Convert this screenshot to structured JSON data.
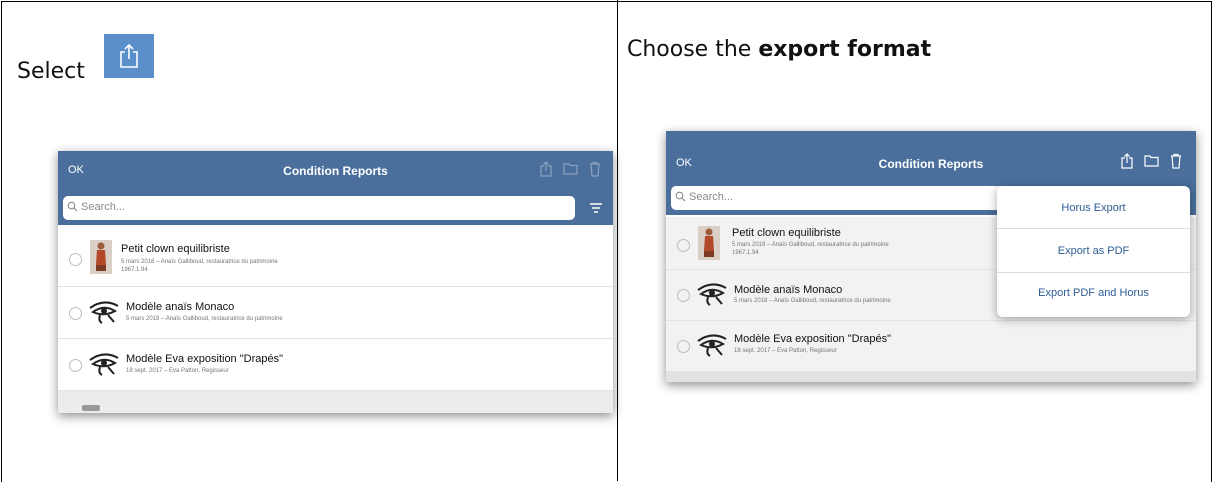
{
  "left_cell": {
    "instruction": "Select",
    "icon": "share-icon"
  },
  "right_cell": {
    "instruction_prefix": "Choose the ",
    "instruction_bold": "export format"
  },
  "app": {
    "ok_label": "OK",
    "title": "Condition Reports",
    "search_placeholder": "Search...",
    "search_placeholder_right": "Search...",
    "nav_color": "#4a6f9c",
    "accent": "#5b8fc9",
    "items": [
      {
        "title": "Petit clown equilibriste",
        "subtitle": "5 mars 2018 – Anaïs Galliboud, restauratrice du patrimoine",
        "subtitle2": "1967.1.94",
        "thumb": "statue-thumbnail"
      },
      {
        "title": "Modèle anaïs Monaco",
        "subtitle": "5 mars 2018 – Anaïs Galliboud, restauratrice du patrimoine",
        "thumb": "eye-of-horus-icon"
      },
      {
        "title": "Modèle Eva exposition \"Drapés\"",
        "subtitle": "18 sept. 2017 – Eva Patton, Regisseur",
        "thumb": "eye-of-horus-icon"
      }
    ]
  },
  "export_menu": {
    "items": [
      "Horus Export",
      "Export as PDF",
      "Export PDF and Horus"
    ]
  }
}
